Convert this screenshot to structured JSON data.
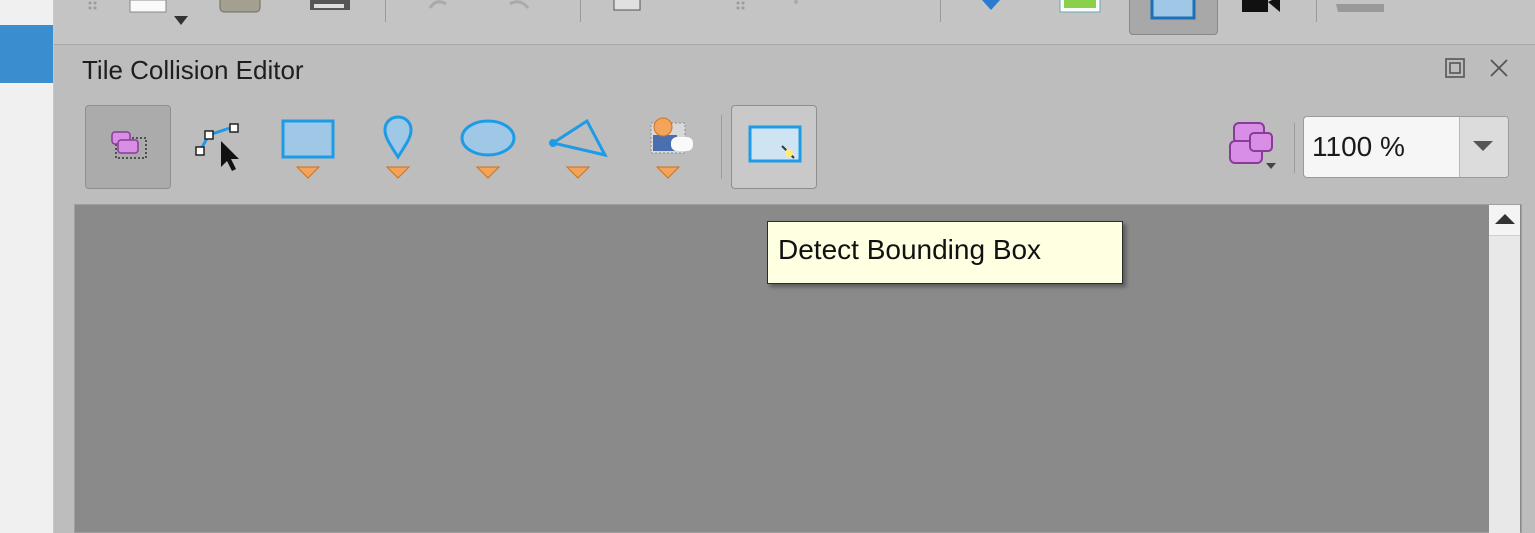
{
  "panel": {
    "title": "Tile Collision Editor"
  },
  "tools": [
    {
      "name": "select-objects",
      "active": true
    },
    {
      "name": "edit-polygons"
    },
    {
      "name": "insert-rectangle"
    },
    {
      "name": "insert-point"
    },
    {
      "name": "insert-ellipse"
    },
    {
      "name": "insert-polygon"
    },
    {
      "name": "insert-tile"
    },
    {
      "name": "detect-bounding-box",
      "checked": true
    }
  ],
  "zoom": {
    "value": "1100 %"
  },
  "tooltip": {
    "text": "Detect Bounding Box"
  },
  "colors": {
    "accent_blue": "#3a8ed0",
    "shape_blue": "#1e9be6",
    "shape_fill": "#9ec8e6",
    "orange_arrow": "#f3a35a",
    "canvas_bg": "#8a8a8a",
    "tooltip_bg": "#ffffe1",
    "layer_purple": "#d98ee6"
  }
}
